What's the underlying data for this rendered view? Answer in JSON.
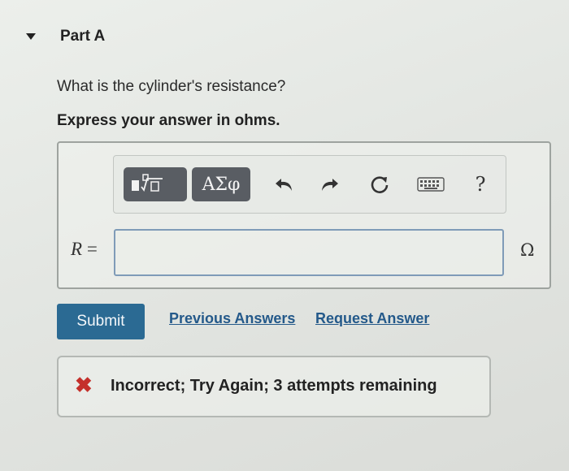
{
  "part": {
    "title": "Part A",
    "collapse_icon": "caret-down-icon"
  },
  "question": {
    "text": "What is the cylinder's resistance?",
    "instruction": "Express your answer in ohms."
  },
  "toolbar": {
    "templates_icon": "math-templates-icon",
    "greek_label": "ΑΣφ",
    "undo_icon": "undo-icon",
    "redo_icon": "redo-icon",
    "reset_icon": "reset-icon",
    "keyboard_icon": "keyboard-icon",
    "help_label": "?"
  },
  "answer": {
    "variable": "R",
    "equals": " =",
    "value": "",
    "unit": "Ω"
  },
  "actions": {
    "submit_label": "Submit",
    "previous_answers_label": "Previous Answers",
    "request_answer_label": "Request Answer"
  },
  "feedback": {
    "icon": "x-icon",
    "text": "Incorrect; Try Again; 3 attempts remaining",
    "status_color": "#c4302b"
  },
  "colors": {
    "submit_bg": "#2b6a93",
    "link": "#24598a",
    "toolbar_button": "#595d63"
  }
}
